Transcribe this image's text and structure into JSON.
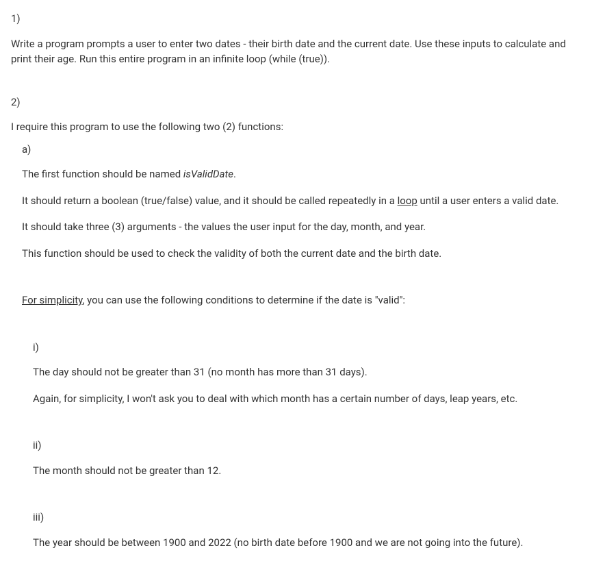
{
  "q1": {
    "number": "1)",
    "text": "Write a program prompts a user to enter two dates - their birth date and the current date. Use these inputs to calculate and print their age. Run this entire program in an infinite loop (while (true))."
  },
  "q2": {
    "number": "2)",
    "intro": "I require this program to use the following two (2) functions:",
    "a": {
      "number": "a)",
      "line1_pre": "The first function should be named ",
      "line1_italic": "isValidDate",
      "line1_post": ".",
      "line2_pre": "It should return a boolean (true/false) value, and it should be called repeatedly in a ",
      "line2_underline": "loop",
      "line2_post": " until a user enters a valid date.",
      "line3": "It should take three (3) arguments - the values the user input for the day, month, and year.",
      "line4": "This function should be used to check the validity of both the current date and the birth date.",
      "simplicity_underline": "For simplicity",
      "simplicity_post": ", you can use the following conditions to determine if the date is \"valid\":",
      "i": {
        "number": "i)",
        "line1": "The day should not be greater than 31 (no month has more than 31 days).",
        "line2": "Again, for simplicity, I won't ask you to deal with which month has a certain number of days, leap years, etc."
      },
      "ii": {
        "number": "ii)",
        "line1": "The month should not be greater than 12."
      },
      "iii": {
        "number": "iii)",
        "line1": "The year should be between 1900 and 2022 (no birth date before 1900 and we are not going into the future)."
      }
    }
  }
}
